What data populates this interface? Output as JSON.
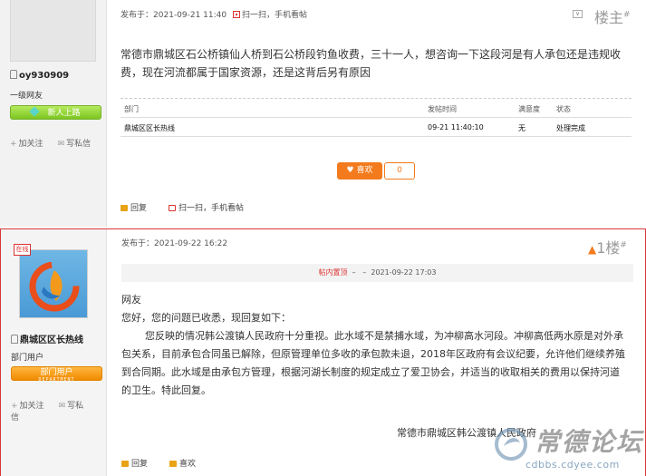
{
  "post1": {
    "username": "oy930909",
    "user_group": "一级网友",
    "rank_badge": "新人上路",
    "follow": "加关注",
    "message": "写私信",
    "posted_label": "发布于：",
    "posted_time": "2021-09-21 11:40",
    "scan_text": "扫一扫，手机看帖",
    "floor": "楼主",
    "floor_symbol": "#",
    "content": "常德市鼎城区石公桥镇仙人桥到石公桥段钓鱼收费，三十一人，想咨询一下这段河是有人承包还是违规收费，现在河流都属于国家资源，还是这背后另有原因",
    "table": {
      "headers": [
        "部门",
        "发帖时间",
        "满意度",
        "状态"
      ],
      "row": [
        "鼎城区区长热线",
        "09-21 11:40:10",
        "无",
        "处理完成"
      ]
    },
    "like_label": "喜欢",
    "like_count": "0",
    "reply": "回复",
    "scan_text_foot": "扫一扫，手机看帖"
  },
  "post2": {
    "online_tag": "在线",
    "username": "鼎城区区长热线",
    "user_group": "部门用户",
    "rank_badge": "部门用户",
    "rank_badge_sub": "DEPARTMENT",
    "follow": "加关注",
    "message": "写私信",
    "posted_label": "发布于：",
    "posted_time": "2021-09-22 16:22",
    "floor": "1楼",
    "floor_symbol": "#",
    "quote_tag": "帖内置顶",
    "quote_dash1": "–",
    "quote_dash2": "–",
    "quote_time": "2021-09-22 17:03",
    "greeting": "网友",
    "line1": "您好，您的问题已收悉，现回复如下：",
    "body": "您反映的情况韩公渡镇人民政府十分重视。此水域不是禁捕水域，为冲柳高水河段。冲柳高低两水原是对外承包关系，目前承包合同虽已解除，但原管理单位多收的承包款未退，2018年区政府有会议纪要，允许他们继续养殖到合同期。此水域是由承包方管理，根据河湖长制度的规定成立了爱卫协会，并适当的收取相关的费用以保持河道的卫生。特此回复。",
    "signature": "常德市鼎城区韩公渡镇人民政府",
    "reply": "回复",
    "like": "喜欢"
  },
  "watermark": {
    "text": "常德论坛",
    "url": "cdbbs.cdyee.com"
  },
  "colors": {
    "accent_orange": "#f37b1d",
    "highlight_red": "#d9383a",
    "badge_green": "#7cc521"
  }
}
